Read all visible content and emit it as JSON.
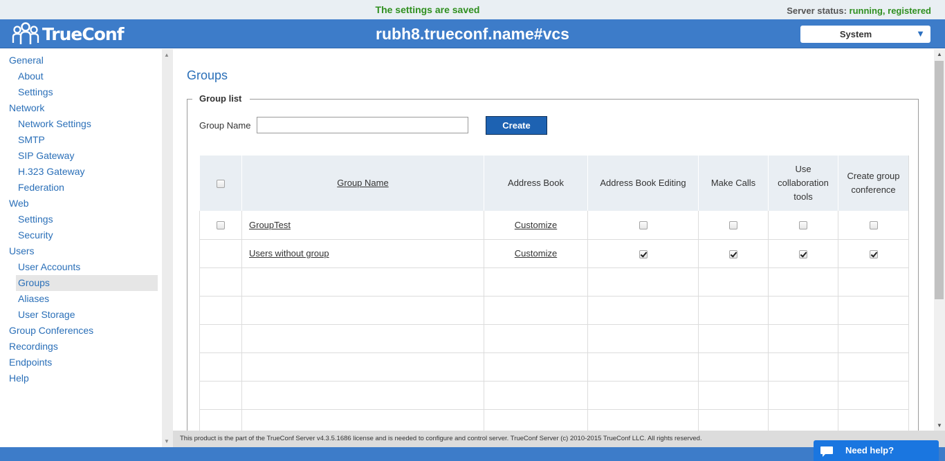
{
  "notice": {
    "message": "The settings are saved"
  },
  "status": {
    "label": "Server status:",
    "value": "running, registered"
  },
  "header": {
    "logo_text": "TrueConf",
    "server_name": "rubh8.trueconf.name#vcs",
    "system_select": "System"
  },
  "sidebar": {
    "items": [
      {
        "label": "General",
        "level": 1
      },
      {
        "label": "About",
        "level": 2
      },
      {
        "label": "Settings",
        "level": 2
      },
      {
        "label": "Network",
        "level": 1
      },
      {
        "label": "Network Settings",
        "level": 2
      },
      {
        "label": "SMTP",
        "level": 2
      },
      {
        "label": "SIP Gateway",
        "level": 2
      },
      {
        "label": "H.323 Gateway",
        "level": 2
      },
      {
        "label": "Federation",
        "level": 2
      },
      {
        "label": "Web",
        "level": 1
      },
      {
        "label": "Settings",
        "level": 2
      },
      {
        "label": "Security",
        "level": 2
      },
      {
        "label": "Users",
        "level": 1
      },
      {
        "label": "User Accounts",
        "level": 2
      },
      {
        "label": "Groups",
        "level": 2,
        "active": true
      },
      {
        "label": "Aliases",
        "level": 2
      },
      {
        "label": "User Storage",
        "level": 2
      },
      {
        "label": "Group Conferences",
        "level": 1
      },
      {
        "label": "Recordings",
        "level": 1
      },
      {
        "label": "Endpoints",
        "level": 1
      },
      {
        "label": "Help",
        "level": 1
      }
    ]
  },
  "main": {
    "title": "Groups",
    "legend": "Group list",
    "group_name_label": "Group Name",
    "group_name_value": "",
    "create_label": "Create",
    "table": {
      "headers": [
        "Group Name",
        "Address Book",
        "Address Book Editing",
        "Make Calls",
        "Use collaboration tools",
        "Create group conference"
      ],
      "rows": [
        {
          "name": "GroupTest",
          "address_book": "Customize",
          "selectable": true,
          "perms": [
            false,
            false,
            false,
            false
          ]
        },
        {
          "name": "Users without group",
          "address_book": "Customize",
          "selectable": false,
          "perms": [
            true,
            true,
            true,
            true
          ]
        }
      ],
      "empty_rows": 6
    }
  },
  "footer": {
    "text": "This product is the part of the TrueConf Server v4.3.5.1686 license and is needed to configure and control server. TrueConf Server (c) 2010-2015 TrueConf LLC. All rights reserved."
  },
  "help": {
    "label": "Need help?"
  }
}
